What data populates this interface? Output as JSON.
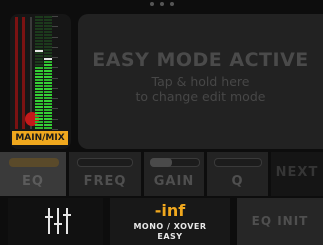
{
  "meter": {
    "channel_label": "MAIN/MIX",
    "fader_level": 0.12,
    "left_level": 0.55,
    "right_level": 0.62
  },
  "easy_mode": {
    "title": "EASY MODE ACTIVE",
    "subtitle_line1": "Tap & hold here",
    "subtitle_line2": "to change edit mode"
  },
  "tabs": [
    {
      "label": "EQ",
      "active": true
    },
    {
      "label": "FREQ",
      "active": false
    },
    {
      "label": "GAIN",
      "active": false
    },
    {
      "label": "Q",
      "active": false
    },
    {
      "label": "NEXT",
      "active": false
    }
  ],
  "bottom": {
    "mixer_icon": "fader-sliders-icon",
    "gain_value": "-inf",
    "mode_line1": "MONO / XOVER",
    "mode_line2": "EASY",
    "eq_init_label": "EQ INIT"
  },
  "colors": {
    "accent": "#f0a81e",
    "meter_green": "#2db82d",
    "fader_red": "#c41a1a"
  }
}
